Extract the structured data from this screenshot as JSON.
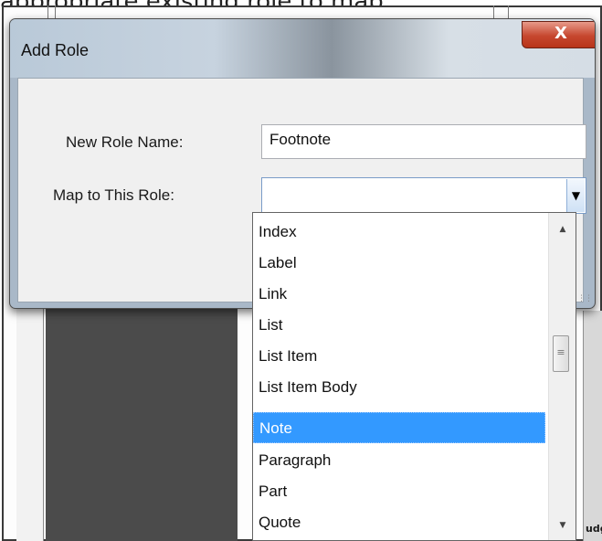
{
  "background": {
    "top_caption": "appropriate existing role to map",
    "corner_text": "udg"
  },
  "dialog": {
    "title": "Add Role",
    "close_glyph": "X",
    "new_role_label": "New Role Name:",
    "new_role_value": "Footnote",
    "map_role_label": "Map to This Role:",
    "map_role_value": "",
    "combo_arrow_icon": "chevron-down-icon"
  },
  "dropdown": {
    "items": [
      "Index",
      "Label",
      "Link",
      "List",
      "List Item",
      "List Item Body",
      "Note",
      "Paragraph",
      "Part",
      "Quote"
    ],
    "selected": "Note",
    "selected_color": "#3399ff"
  }
}
